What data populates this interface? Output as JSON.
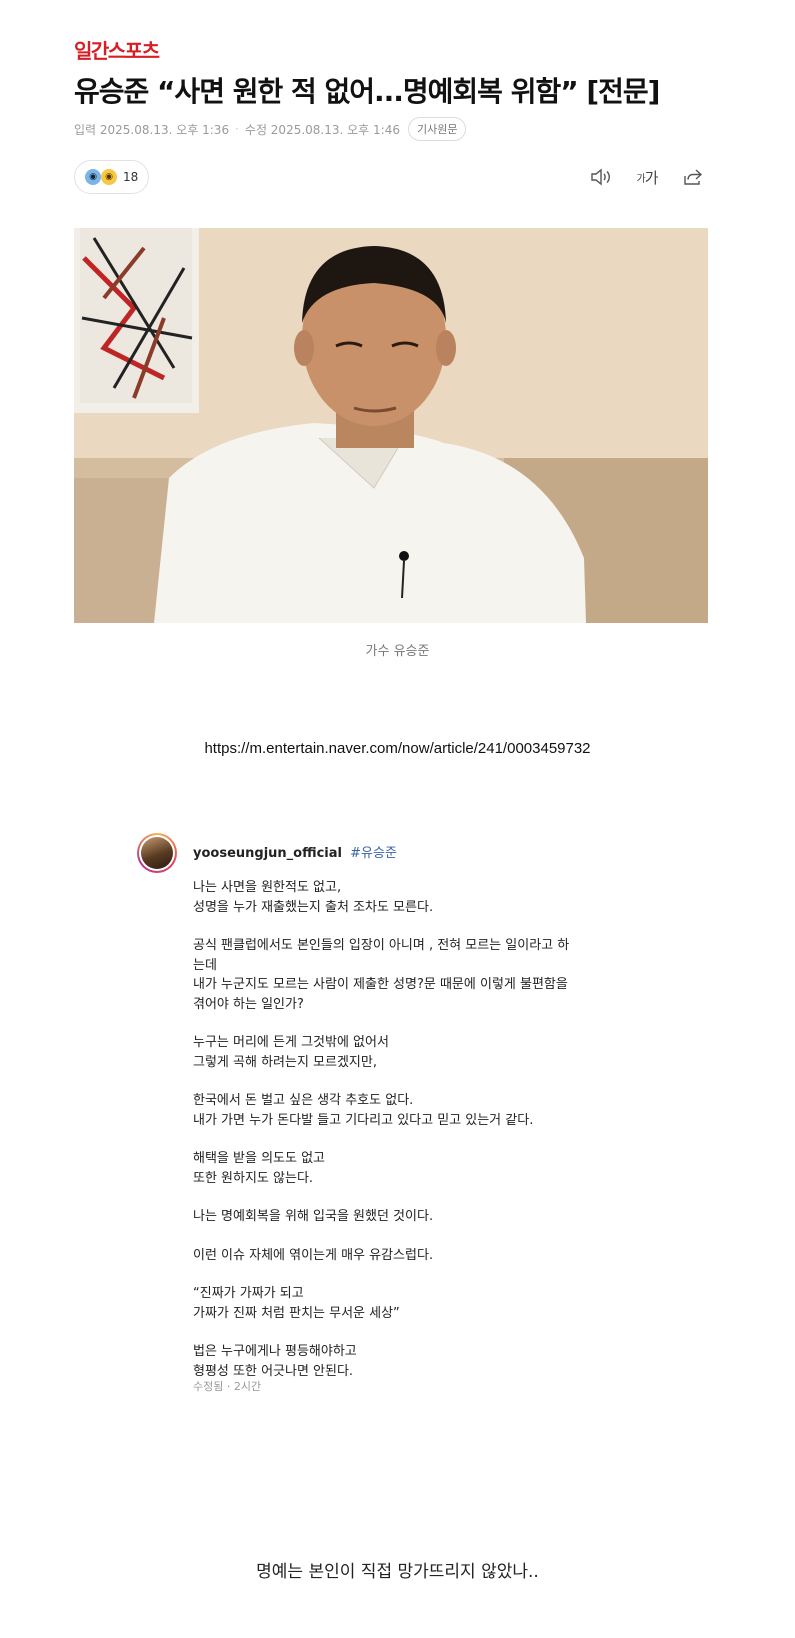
{
  "header": {
    "brand": "일간스포츠",
    "headline": "유승준 “사면 원한 적 없어...명예회복 위함” [전문]",
    "published": "입력 2025.08.13. 오후 1:36",
    "modified": "수정 2025.08.13. 오후 1:46",
    "original_button": "기사원문"
  },
  "reaction": {
    "count": "18",
    "icons": [
      "surprised-face-icon",
      "wow-face-icon"
    ]
  },
  "toolbar": {
    "icons": [
      "speaker-icon",
      "font-size-icon",
      "share-icon"
    ],
    "fontsize_small": "가",
    "fontsize_large": "가"
  },
  "photo": {
    "caption": "가수 유승준"
  },
  "link": {
    "url": "https://m.entertain.naver.com/now/article/241/0003459732"
  },
  "instagram": {
    "username": "yooseungjun_official",
    "hashtag": "#유승준",
    "paragraphs": [
      [
        "나는 사면을 원한적도 없고,",
        "성명을 누가 재출했는지 출처 조차도 모른다."
      ],
      [
        "공식 팬클럽에서도 본인들의 입장이 아니며 , 전혀 모르는 일이라고 하",
        "는데",
        "내가 누군지도 모르는 사람이 제출한 성명?문 때문에 이렇게 불편함을",
        "겪어야 하는 일인가?"
      ],
      [
        "누구는 머리에 든게 그것밖에 없어서",
        "그렇게 곡해 하려는지 모르겠지만,"
      ],
      [
        "한국에서 돈 벌고 싶은 생각 추호도 없다.",
        "내가 가면 누가 돈다발 들고 기다리고 있다고 믿고 있는거 같다."
      ],
      [
        "해택을 받을 의도도 없고",
        "또한 원하지도 않는다."
      ],
      [
        "나는 명예회복을 위해 입국을 원했던 것이다."
      ],
      [
        "이런 이슈 자체에 엮이는게 매우 유감스럽다."
      ],
      [
        "“진짜가 가짜가 되고",
        "가짜가 진짜 처럼 판치는 무서운 세상”"
      ],
      [
        "법은 누구에게나 평등해야하고",
        "형평성 또한 어긋나면 안된다."
      ]
    ],
    "edited": "수정됨 · 2시간"
  },
  "footer": {
    "comment": "명예는 본인이 직접 망가뜨리지 않았나.."
  }
}
